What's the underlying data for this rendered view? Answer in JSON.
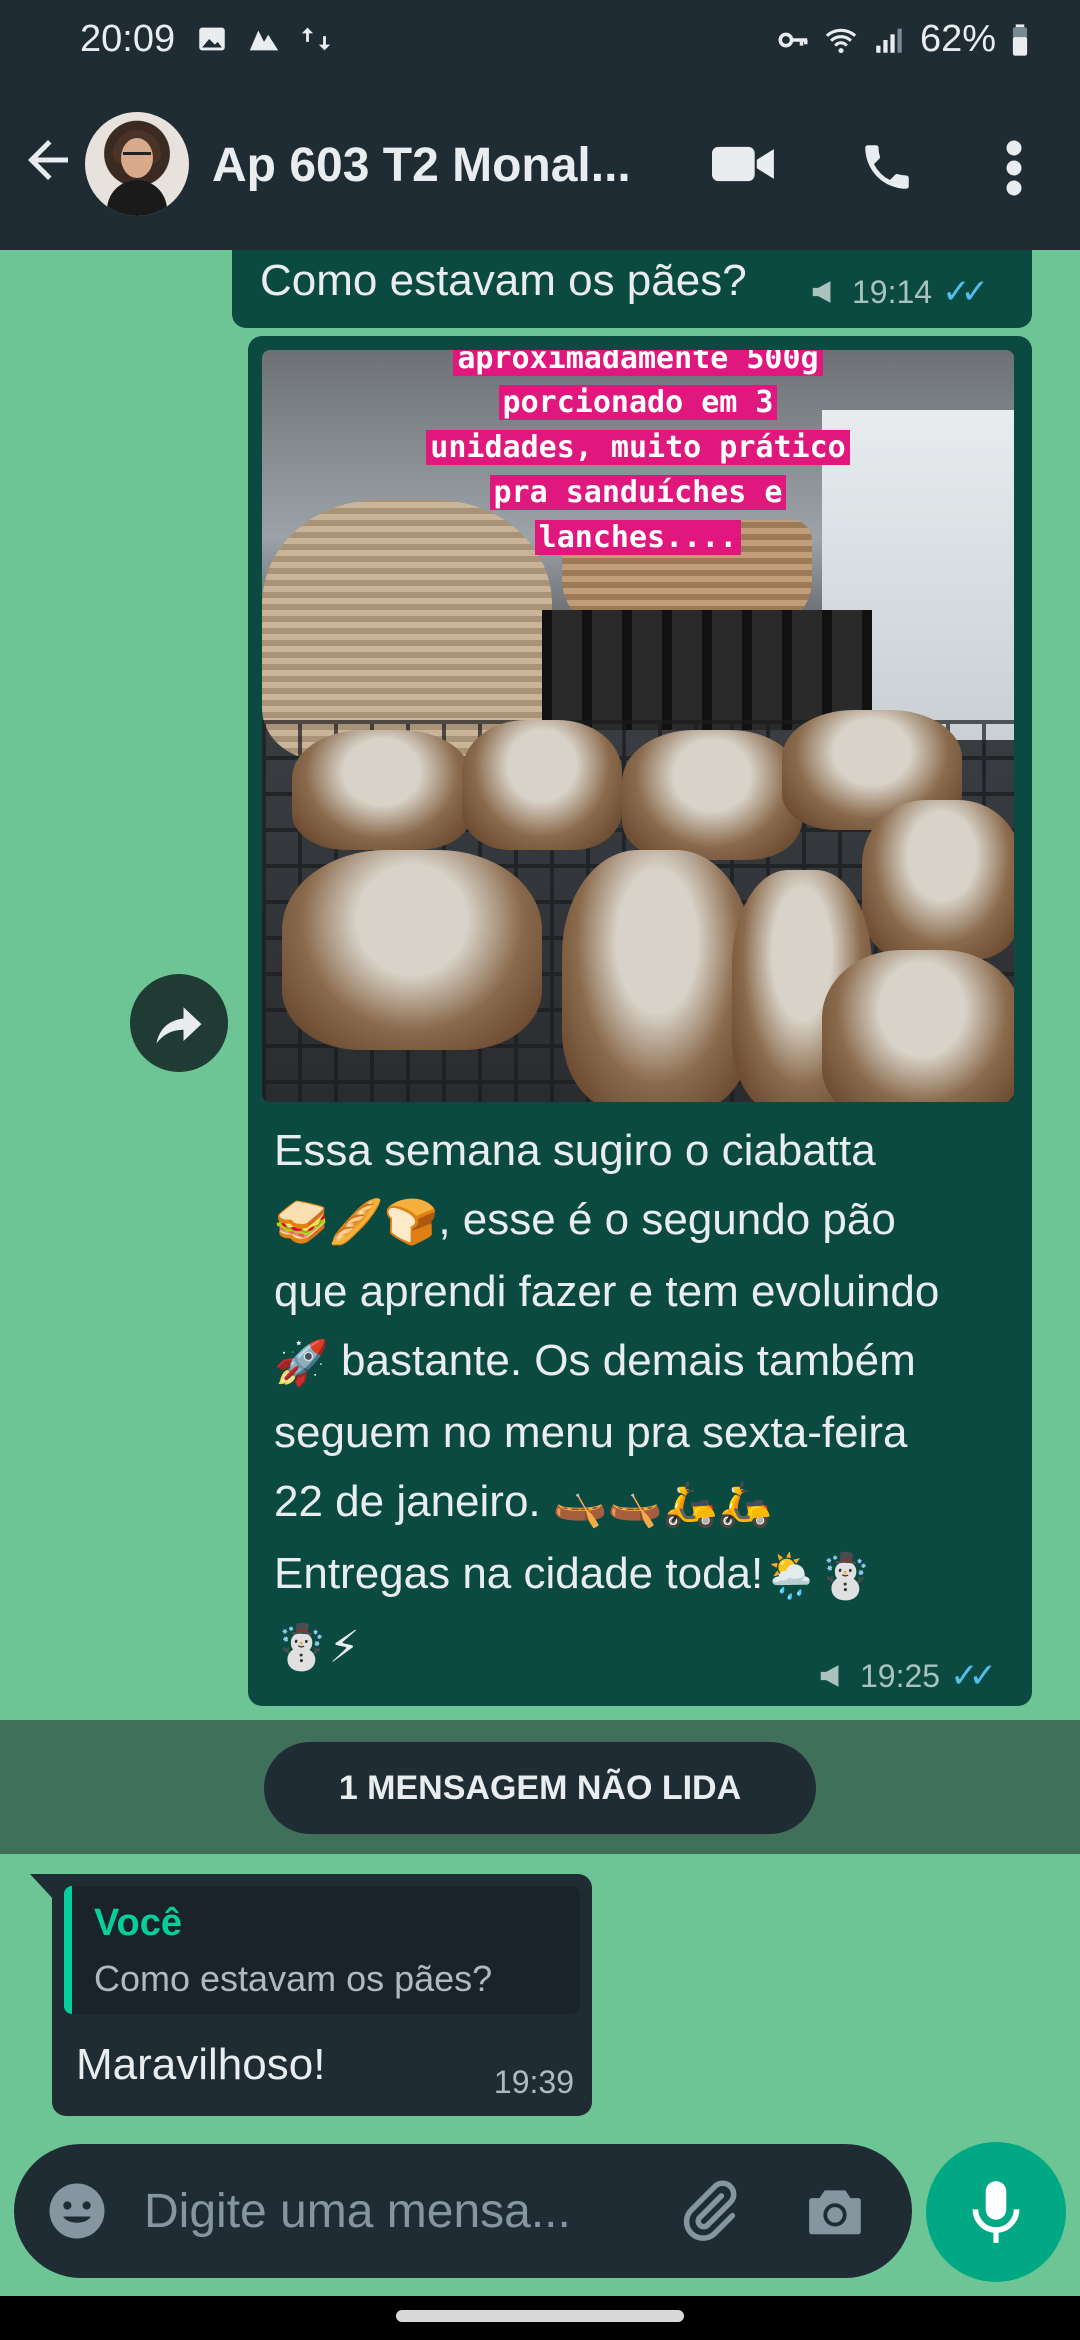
{
  "status_bar": {
    "time": "20:09",
    "battery": "62%",
    "icons_left": [
      "gallery-icon",
      "mountain-icon",
      "transfer-icon"
    ],
    "icons_right": [
      "key-icon",
      "wifi-icon",
      "signal-icon",
      "battery-icon"
    ]
  },
  "header": {
    "title": "Ap 603 T2 Monal...",
    "icons": [
      "back-arrow-icon",
      "video-call-icon",
      "phone-call-icon",
      "more-vert-icon"
    ]
  },
  "messages": {
    "out_top": {
      "text": "Como estavam os pães?",
      "time": "19:14"
    },
    "out_image": {
      "caption_lines": [
        "aproximadamente 500g",
        "porcionado em 3",
        "unidades, muito prático",
        "pra sanduíches e",
        "lanches...."
      ],
      "text_lines": [
        "Essa semana sugiro o ciabatta",
        ", esse é o segundo pão",
        "que aprendi fazer e tem evoluindo",
        " bastante. Os demais também",
        "seguem no menu pra sexta-feira",
        "22 de janeiro.",
        "Entregas na cidade toda!"
      ],
      "emojis": {
        "line2": "🥪🥖🍞",
        "line4": "🚀",
        "line6": "🛶🛶🛵🛵",
        "line7": "🌦️☃️",
        "line8": "☃️⚡"
      },
      "time": "19:25"
    },
    "unread_label": "1 MENSAGEM NÃO LIDA",
    "incoming": {
      "quote_author": "Você",
      "quote_text": "Como estavam os pães?",
      "text": "Maravilhoso!",
      "time": "19:39"
    }
  },
  "composer": {
    "placeholder": "Digite uma mensa..."
  },
  "colors": {
    "wallpaper": "#6dc596",
    "header": "#1f2c34",
    "bubble_out": "#0b4a40",
    "bubble_in": "#202c33",
    "accent": "#00a884",
    "read_ticks": "#53bdeb"
  }
}
